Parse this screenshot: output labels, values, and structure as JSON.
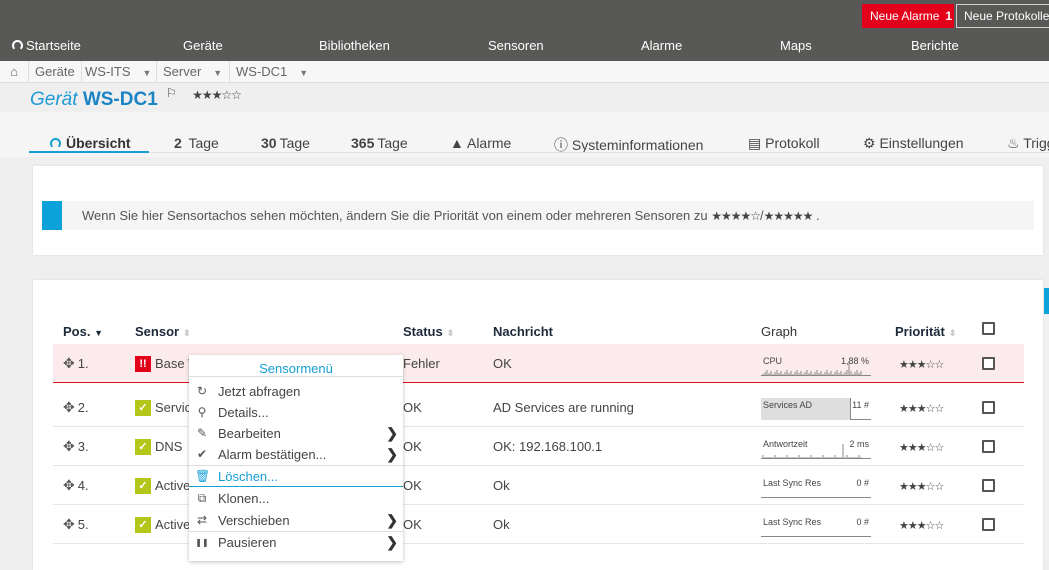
{
  "topbar": {
    "new_alarms_label": "Neue Alarme",
    "new_alarms_count": "1",
    "new_logs_label": "Neue Protokolleinträge"
  },
  "mainnav": {
    "items": [
      "Startseite",
      "Geräte",
      "Bibliotheken",
      "Sensoren",
      "Alarme",
      "Maps",
      "Berichte"
    ]
  },
  "breadcrumb": {
    "items": [
      "Geräte",
      "WS-ITS",
      "Server",
      "WS-DC1"
    ]
  },
  "device": {
    "prefix": "Gerät",
    "name": "WS-DC1",
    "priority_stars": 3,
    "priority_display": "★★★☆☆"
  },
  "tabs": [
    {
      "label": "Übersicht",
      "icon": "gauge-icon"
    },
    {
      "num": "2",
      "label": "Tage"
    },
    {
      "num": "30",
      "label": "Tage"
    },
    {
      "num": "365",
      "label": "Tage"
    },
    {
      "label": "Alarme",
      "icon": "warning-icon"
    },
    {
      "label": "Systeminformationen",
      "icon": "info-icon"
    },
    {
      "label": "Protokoll",
      "icon": "log-icon"
    },
    {
      "label": "Einstellungen",
      "icon": "gear-icon"
    },
    {
      "label": "Trigger",
      "icon": "bell-icon"
    }
  ],
  "info": {
    "text": "Wenn Sie hier Sensortachos sehen möchten, ändern Sie die Priorität von einem oder mehreren Sensoren zu",
    "stars_a": "★★★★☆",
    "sep": "/",
    "stars_b": "★★★★★",
    "end": "."
  },
  "table": {
    "headers": {
      "pos": "Pos.",
      "sensor": "Sensor",
      "status": "Status",
      "message": "Nachricht",
      "graph": "Graph",
      "priority": "Priorität"
    },
    "rows": [
      {
        "pos": "1.",
        "sensor": "Base W",
        "state": "error",
        "status": "Fehler",
        "message": "OK",
        "graph_label": "CPU",
        "graph_value": "1,88 %",
        "graph_type": "spark",
        "priority": 3,
        "priority_display": "★★★☆☆"
      },
      {
        "pos": "2.",
        "sensor": "Servic",
        "state": "ok",
        "status": "OK",
        "message": "AD Services are running",
        "graph_label": "Services AD",
        "graph_value": "11 #",
        "graph_type": "bar",
        "priority": 3,
        "priority_display": "★★★☆☆"
      },
      {
        "pos": "3.",
        "sensor": "DNS",
        "state": "ok",
        "status": "OK",
        "message": "OK: 192.168.100.1",
        "graph_label": "Antwortzeit",
        "graph_value": "2 ms",
        "graph_type": "spark",
        "priority": 3,
        "priority_display": "★★★☆☆"
      },
      {
        "pos": "4.",
        "sensor": "Active",
        "state": "ok",
        "status": "OK",
        "message": "Ok",
        "graph_label": "Last Sync Res",
        "graph_value": "0 #",
        "graph_type": "flat",
        "priority": 3,
        "priority_display": "★★★☆☆"
      },
      {
        "pos": "5.",
        "sensor": "Active",
        "state": "ok",
        "status": "OK",
        "message": "Ok",
        "graph_label": "Last Sync Res",
        "graph_value": "0 #",
        "graph_type": "flat",
        "priority": 3,
        "priority_display": "★★★☆☆"
      }
    ]
  },
  "context_menu": {
    "title": "Sensormenü",
    "items": [
      {
        "label": "Jetzt abfragen",
        "icon": "refresh-icon",
        "submenu": false
      },
      {
        "label": "Details...",
        "icon": "search-icon",
        "submenu": false
      },
      {
        "label": "Bearbeiten",
        "icon": "edit-icon",
        "submenu": true
      },
      {
        "label": "Alarm bestätigen...",
        "icon": "check-icon",
        "submenu": true
      },
      {
        "label": "Löschen...",
        "icon": "trash-icon",
        "submenu": false,
        "highlighted": true
      },
      {
        "label": "Klonen...",
        "icon": "clone-icon",
        "submenu": false
      },
      {
        "label": "Verschieben",
        "icon": "shuffle-icon",
        "submenu": true
      },
      {
        "label": "Pausieren",
        "icon": "pause-icon",
        "submenu": true
      }
    ]
  }
}
